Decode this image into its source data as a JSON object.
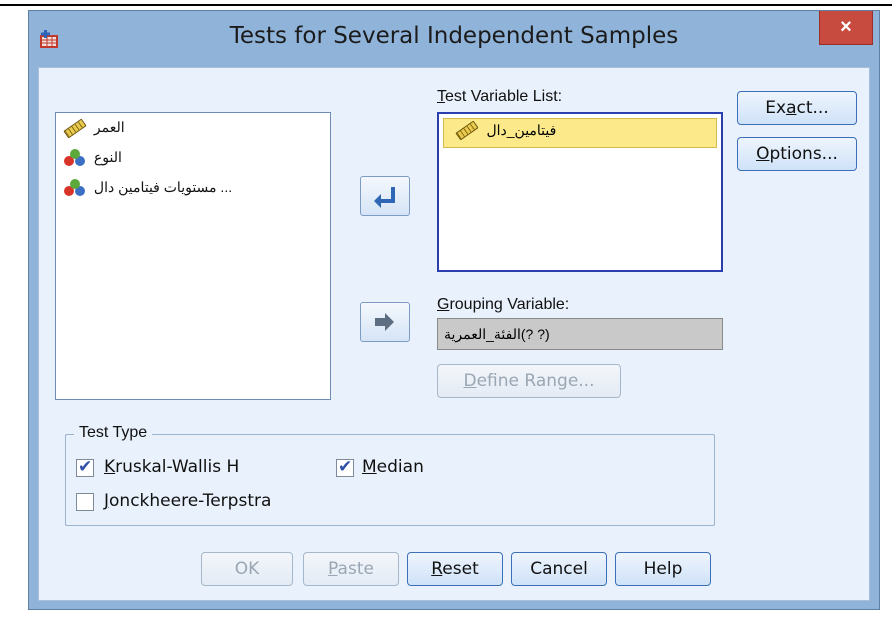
{
  "window": {
    "title": "Tests for Several Independent Samples",
    "close_glyph": "×",
    "accent_color": "#8fb3d9",
    "close_color": "#c74b3f"
  },
  "source_list": {
    "items": [
      {
        "label": "العمر",
        "icon": "scale-ruler-icon"
      },
      {
        "label": "النوع",
        "icon": "nominal-balls-icon"
      },
      {
        "label": "مستويات فيتامين دال ...",
        "icon": "nominal-balls-icon"
      }
    ]
  },
  "test_variable_list": {
    "label_mnemonic": "T",
    "label_rest": "est Variable List:",
    "items": [
      {
        "label": "فيتامين_دال",
        "icon": "scale-ruler-icon",
        "selected": true
      }
    ]
  },
  "grouping_variable": {
    "label_mnemonic": "G",
    "label_rest": "rouping Variable:",
    "value": "الفئة_العمرية(? ?)"
  },
  "define_range": {
    "mnemonic": "D",
    "rest": "efine Range..."
  },
  "side_buttons": {
    "exact": {
      "pre": "Ex",
      "mnemonic": "a",
      "post": "ct..."
    },
    "options": {
      "pre": "",
      "mnemonic": "O",
      "post": "ptions..."
    }
  },
  "test_type": {
    "legend": "Test Type",
    "kruskal": {
      "mnemonic": "K",
      "rest": "ruskal-Wallis H",
      "checked": true
    },
    "median": {
      "mnemonic": "M",
      "rest": "edian",
      "checked": true
    },
    "jonckheere": {
      "mnemonic": "J",
      "rest": "onckheere-Terpstra",
      "checked": false
    }
  },
  "footer": {
    "ok": "OK",
    "paste": {
      "mnemonic": "P",
      "rest": "aste"
    },
    "reset": {
      "mnemonic": "R",
      "rest": "eset"
    },
    "cancel": "Cancel",
    "help": "Help"
  },
  "check_glyph": "✔"
}
